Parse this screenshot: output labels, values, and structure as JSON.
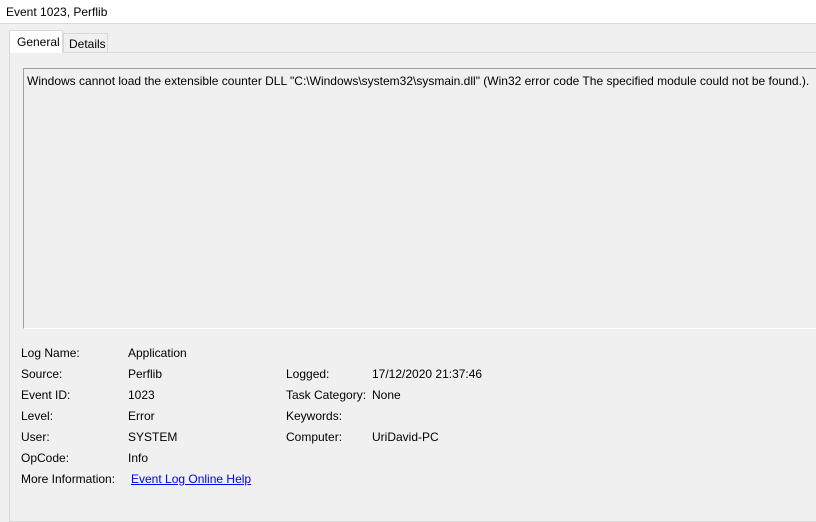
{
  "window": {
    "title": "Event 1023, Perflib"
  },
  "tabs": [
    {
      "label": "General",
      "selected": true
    },
    {
      "label": "Details",
      "selected": false
    }
  ],
  "message": "Windows cannot load the extensible counter DLL \"C:\\Windows\\system32\\sysmain.dll\" (Win32 error code The specified module could not be found.).",
  "details": {
    "log_name": {
      "label": "Log Name:",
      "value": "Application"
    },
    "source": {
      "label": "Source:",
      "value": "Perflib"
    },
    "event_id": {
      "label": "Event ID:",
      "value": "1023"
    },
    "level": {
      "label": "Level:",
      "value": "Error"
    },
    "user": {
      "label": "User:",
      "value": "SYSTEM"
    },
    "opcode": {
      "label": "OpCode:",
      "value": "Info"
    },
    "more_info": {
      "label": "More Information:",
      "link_text": "Event Log Online Help"
    },
    "logged": {
      "label": "Logged:",
      "value": "17/12/2020 21:37:46"
    },
    "task_category": {
      "label": "Task Category:",
      "value": "None"
    },
    "keywords": {
      "label": "Keywords:",
      "value": ""
    },
    "computer": {
      "label": "Computer:",
      "value": "UriDavid-PC"
    }
  },
  "colors": {
    "background": "#f0f0f0",
    "title_background": "#ffffff",
    "link": "#0000ee"
  }
}
